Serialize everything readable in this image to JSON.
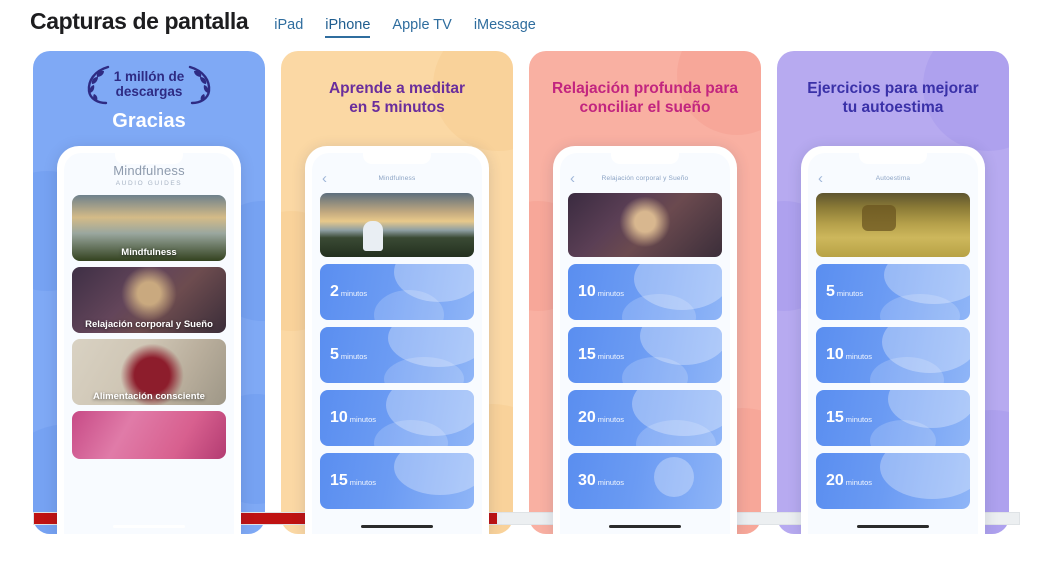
{
  "header": {
    "title": "Capturas de pantalla",
    "tabs": [
      {
        "label": "iPad",
        "active": false
      },
      {
        "label": "iPhone",
        "active": true
      },
      {
        "label": "Apple TV",
        "active": false
      },
      {
        "label": "iMessage",
        "active": false
      }
    ]
  },
  "colors": {
    "card1_bg": "#7fa9f5",
    "card2_bg": "#fbd8a4",
    "card3_bg": "#f9b0a2",
    "card4_bg": "#b7aaf0",
    "card1_title": "#ffffff",
    "card2_title": "#6a2d9c",
    "card3_title": "#c2257f",
    "card4_title": "#3a31a8",
    "tab_link": "#2f6d9e",
    "scrollbar_thumb": "#bf1212",
    "tile_blue": "#5a8ef0"
  },
  "cards": [
    {
      "id": "card-gracias",
      "badge_text": "1 millón de\ndescargas",
      "headline": "Gracias",
      "app_name": "Mindfulness",
      "app_subtitle": "AUDIO GUIDES",
      "rows": [
        {
          "label": "Mindfulness"
        },
        {
          "label": "Relajación corporal y Sueño"
        },
        {
          "label": "Alimentación consciente"
        },
        {
          "label": ""
        }
      ]
    },
    {
      "id": "card-aprende",
      "title": "Aprende a meditar\nen 5 minutos",
      "nav_title": "Mindfulness",
      "hero": "hero-mindful",
      "items": [
        {
          "num": "2",
          "unit": "minutos"
        },
        {
          "num": "5",
          "unit": "minutos"
        },
        {
          "num": "10",
          "unit": "minutos"
        },
        {
          "num": "15",
          "unit": "minutos"
        }
      ]
    },
    {
      "id": "card-relajacion",
      "title": "Relajación profunda para\nconciliar el sueño",
      "nav_title": "Relajación corporal y Sueño",
      "hero": "hero-relax",
      "items": [
        {
          "num": "10",
          "unit": "minutos"
        },
        {
          "num": "15",
          "unit": "minutos"
        },
        {
          "num": "20",
          "unit": "minutos"
        },
        {
          "num": "30",
          "unit": "minutos"
        }
      ]
    },
    {
      "id": "card-autoestima",
      "title": "Ejercicios para mejorar\ntu autoestima",
      "nav_title": "Autoestima",
      "hero": "hero-auto",
      "items": [
        {
          "num": "5",
          "unit": "minutos"
        },
        {
          "num": "10",
          "unit": "minutos"
        },
        {
          "num": "15",
          "unit": "minutos"
        },
        {
          "num": "20",
          "unit": "minutos"
        }
      ]
    }
  ],
  "scrollbar": {
    "thumb_percent": "47"
  },
  "icons": {
    "back_chevron": "‹",
    "laurel_left": "❨",
    "laurel_right": "❨"
  }
}
